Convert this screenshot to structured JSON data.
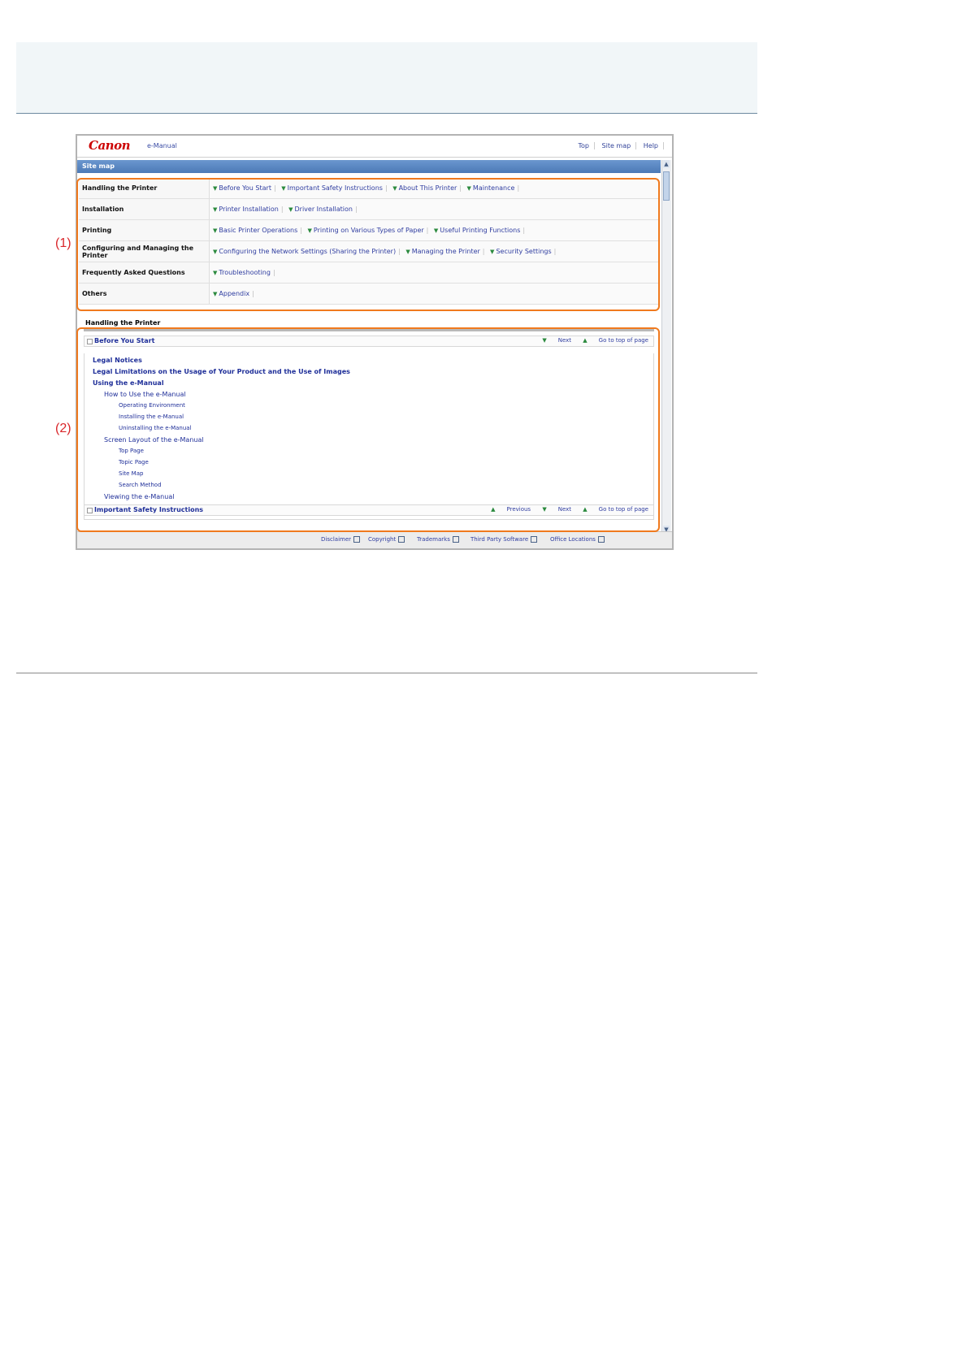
{
  "header": {
    "logo": "Canon",
    "product": "e-Manual",
    "links": [
      "Top",
      "Site map",
      "Help"
    ]
  },
  "section_title": "Site map",
  "sitemap": [
    {
      "category": "Handling the Printer",
      "links": [
        "Before You Start",
        "Important Safety Instructions",
        "About This Printer",
        "Maintenance"
      ]
    },
    {
      "category": "Installation",
      "links": [
        "Printer Installation",
        "Driver Installation"
      ]
    },
    {
      "category": "Printing",
      "links": [
        "Basic Printer Operations",
        "Printing on Various Types of Paper",
        "Useful Printing Functions"
      ]
    },
    {
      "category": "Configuring and Managing the Printer",
      "links": [
        "Configuring the Network Settings (Sharing the Printer)",
        "Managing the Printer",
        "Security Settings"
      ]
    },
    {
      "category": "Frequently Asked Questions",
      "links": [
        "Troubleshooting"
      ]
    },
    {
      "category": "Others",
      "links": [
        "Appendix"
      ]
    }
  ],
  "detail": {
    "title": "Handling the Printer",
    "entry1": {
      "title": "Before You Start",
      "next": "Next",
      "top": "Go to top of page"
    },
    "tree": [
      "Legal Notices",
      "Legal Limitations on the Usage of Your Product and the Use of Images",
      "Using the e-Manual",
      "How to Use the e-Manual",
      "Operating Environment",
      "Installing the e-Manual",
      "Uninstalling the e-Manual",
      "Screen Layout of the e-Manual",
      "Top Page",
      "Topic Page",
      "Site Map",
      "Search Method",
      "Viewing the e-Manual"
    ],
    "entry2": {
      "title": "Important Safety Instructions",
      "previous": "Previous",
      "next": "Next",
      "top": "Go to top of page"
    }
  },
  "footer": [
    "Disclaimer",
    "Copyright",
    "Trademarks",
    "Third Party Software",
    "Office Locations"
  ],
  "callouts": {
    "one": "(1)",
    "two": "(2)"
  },
  "colors": {
    "highlight": "#f07a1e",
    "callout": "#d9262a",
    "bar": "#4c79b6"
  }
}
